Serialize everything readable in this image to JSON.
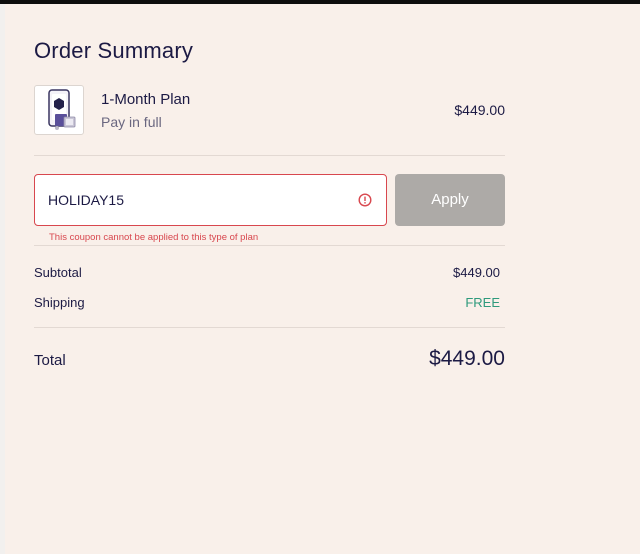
{
  "order": {
    "title": "Order Summary",
    "item": {
      "thumbnail_icon": "phone-with-product-icon",
      "name": "1-Month Plan",
      "subtitle": "Pay in full",
      "price": "$449.00"
    }
  },
  "coupon": {
    "value": "HOLIDAY15",
    "error_icon": "exclamation-circle-icon",
    "error_message": "This coupon cannot be applied to this type of plan",
    "apply_label": "Apply"
  },
  "summary": {
    "subtotal_label": "Subtotal",
    "subtotal_value": "$449.00",
    "shipping_label": "Shipping",
    "shipping_value": "FREE",
    "total_label": "Total",
    "total_value": "$449.00"
  },
  "colors": {
    "background": "#f9f0ea",
    "text": "#1c1a44",
    "error": "#d8474e",
    "free": "#2e9a7c",
    "apply_disabled": "#adaaa7"
  }
}
